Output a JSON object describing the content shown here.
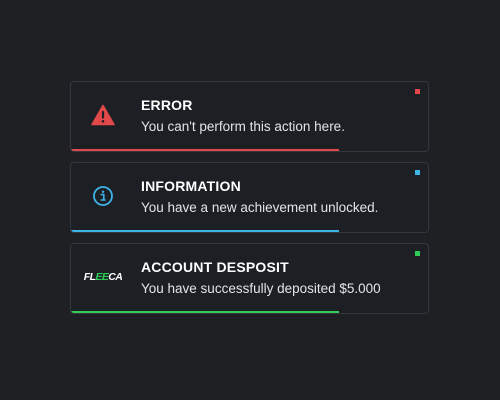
{
  "notifications": [
    {
      "type": "error",
      "title": "ERROR",
      "message": "You can't perform this action here.",
      "icon": "warning-triangle-icon",
      "color": "#e0484a",
      "progress": 0.75
    },
    {
      "type": "info",
      "title": "INFORMATION",
      "message": "You have a new achievement unlocked.",
      "icon": "info-circle-icon",
      "color": "#3db5e8",
      "progress": 0.75
    },
    {
      "type": "success",
      "title": "ACCOUNT DESPOSIT",
      "message": "You have successfully deposited $5.000",
      "icon": "fleeca-logo",
      "logo_text": {
        "prefix": "FL",
        "highlight": "EE",
        "suffix": "CA"
      },
      "color": "#2fcd57",
      "progress": 0.75
    }
  ]
}
